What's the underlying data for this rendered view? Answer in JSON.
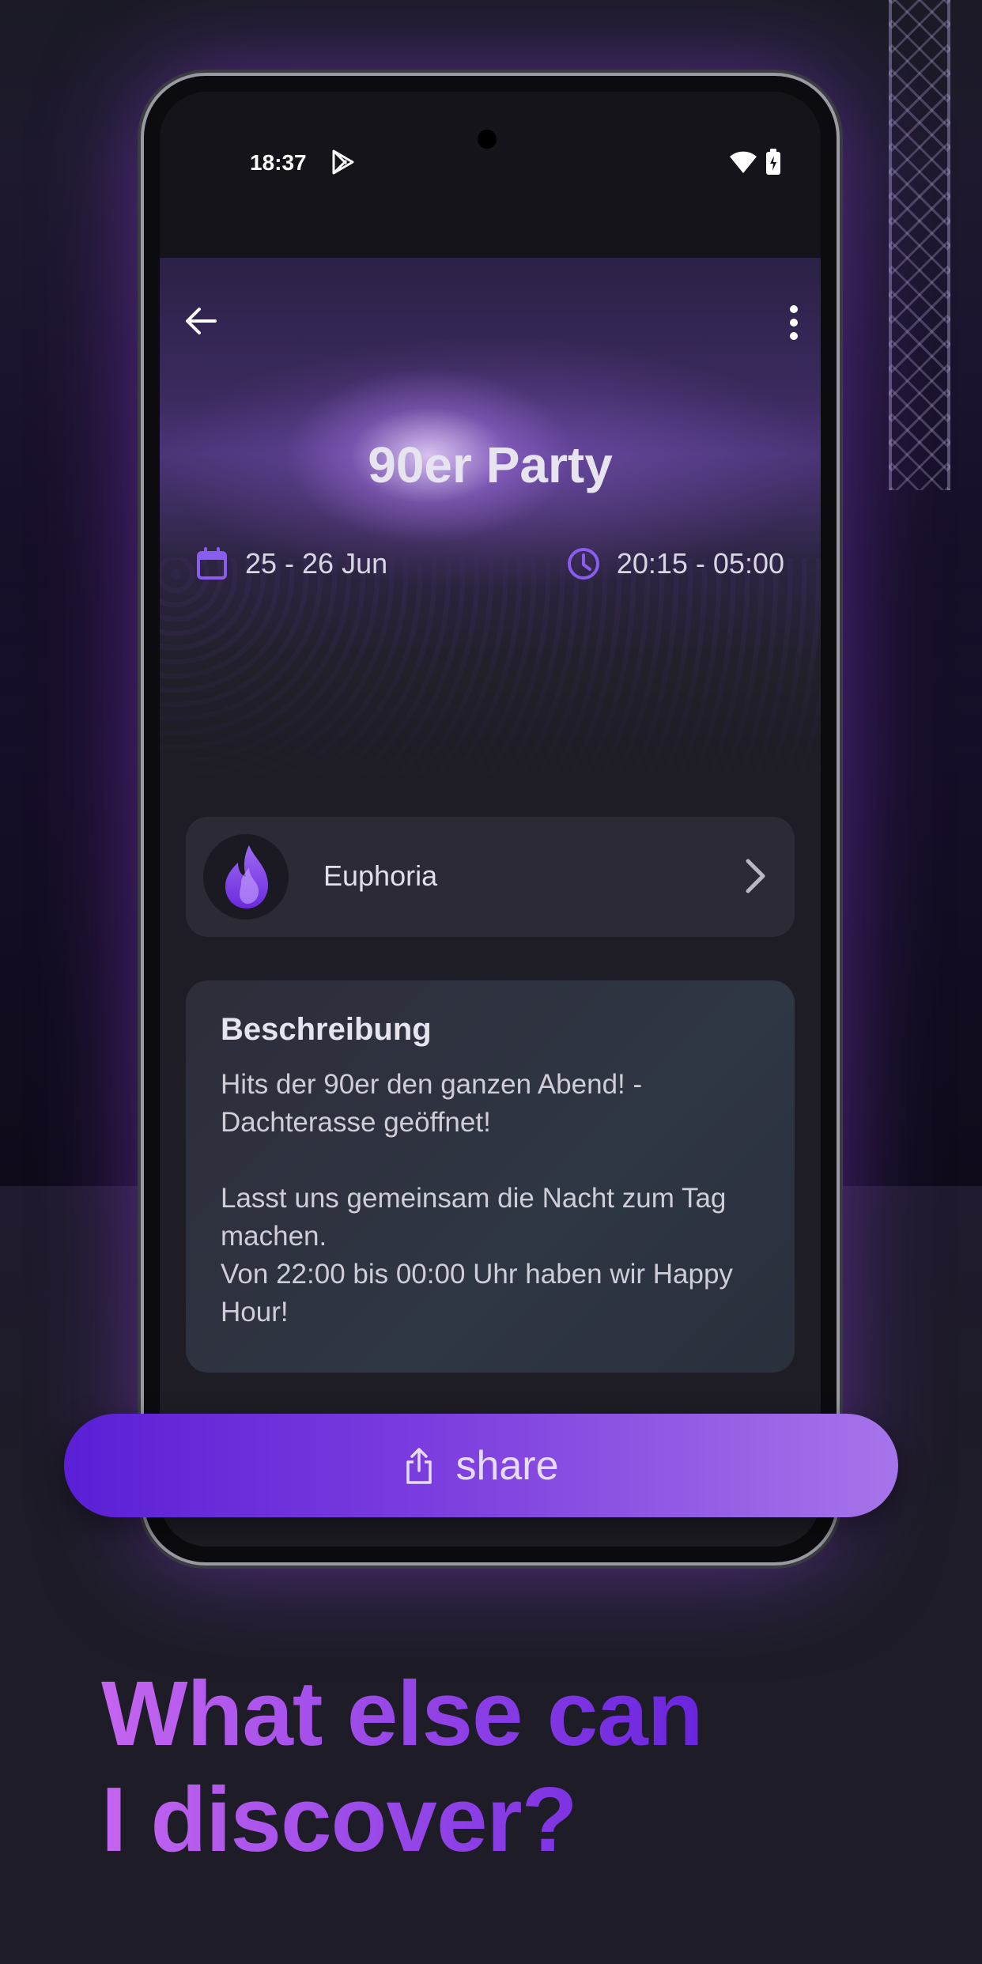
{
  "status_bar": {
    "time": "18:37"
  },
  "event": {
    "title": "90er Party",
    "date": "25 - 26 Jun",
    "time_range": "20:15 - 05:00"
  },
  "organizer": {
    "name": "Euphoria"
  },
  "description": {
    "heading": "Beschreibung",
    "body": "Hits der 90er den ganzen Abend! -\nDachterasse geöffnet!\n\nLasst uns gemeinsam die Nacht zum Tag\nmachen.\nVon 22:00 bis 00:00 Uhr haben wir Happy\nHour!"
  },
  "share_button": {
    "label": "share",
    "icon": "share-icon"
  },
  "headline": {
    "line1": "What else can",
    "line2": "I discover?"
  },
  "colors": {
    "accent": "#7c3ede",
    "accent_light": "#a674ea",
    "background": "#1d1c27",
    "card": "#2b2a35"
  }
}
